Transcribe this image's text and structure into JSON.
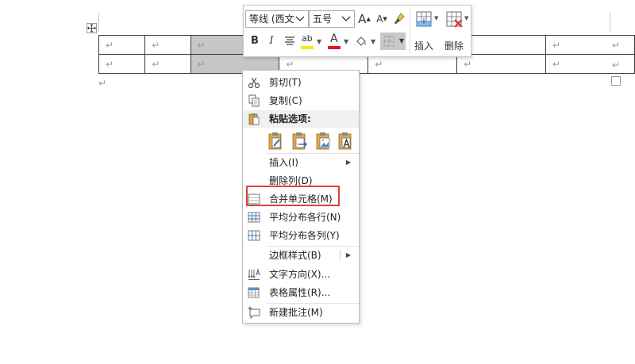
{
  "document": {
    "paragraph_mark": "↵",
    "move_handle_icon": "table-move-handle-icon",
    "resize_handle_icon": "table-resize-handle-icon",
    "table_rows": [
      [
        "↵",
        "↵",
        "↵",
        "↵",
        "↵",
        "↵",
        "↵"
      ],
      [
        "↵",
        "↵",
        "↵",
        "↵",
        "↵",
        "↵",
        "↵"
      ]
    ],
    "row_end_marks": [
      "↵",
      "↵"
    ],
    "after_table_mark": "↵"
  },
  "mini_toolbar": {
    "font_name": "等线 (西文",
    "font_size": "五号",
    "grow_font": "A",
    "shrink_font": "A",
    "bold": "B",
    "italic": "I",
    "highlight_glyph": "ab",
    "font_color_glyph": "A",
    "insert_label": "插入",
    "delete_label": "删除",
    "colors": {
      "highlight": "#f5e900",
      "font_color": "#e81123"
    }
  },
  "context_menu": {
    "items": [
      {
        "label": "剪切(T)",
        "icon": "scissors-icon"
      },
      {
        "label": "复制(C)",
        "icon": "copy-icon"
      },
      {
        "label": "粘贴选项:",
        "icon": "clipboard-icon"
      },
      {
        "label": "插入(I)",
        "icon": "",
        "submenu": "▶"
      },
      {
        "label": "删除列(D)",
        "icon": ""
      },
      {
        "label": "合并单元格(M)",
        "icon": "merge-cells-icon"
      },
      {
        "label": "平均分布各行(N)",
        "icon": "distribute-rows-icon"
      },
      {
        "label": "平均分布各列(Y)",
        "icon": "distribute-columns-icon"
      },
      {
        "label": "边框样式(B)",
        "icon": "",
        "submenu": "▶"
      },
      {
        "label": "文字方向(X)...",
        "icon": "text-direction-icon"
      },
      {
        "label": "表格属性(R)...",
        "icon": "table-properties-icon"
      },
      {
        "label": "新建批注(M)",
        "icon": "new-comment-icon"
      }
    ],
    "paste_options": [
      "paste-keep-source-formatting-icon",
      "paste-nest-table-icon",
      "paste-picture-icon",
      "paste-keep-text-only-icon"
    ],
    "highlight_color": "#e0403a"
  }
}
